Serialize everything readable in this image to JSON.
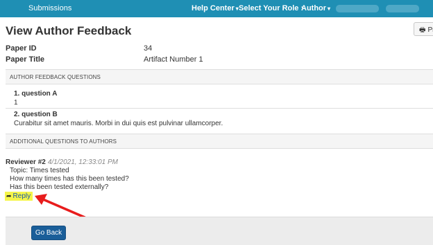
{
  "nav": {
    "submissions": "Submissions",
    "help_center": "Help Center",
    "select_role": "Select Your Role :",
    "role": "Author",
    "caret": "▾"
  },
  "page": {
    "title": "View Author Feedback",
    "print_label": "Pr"
  },
  "info": [
    {
      "label": "Paper ID",
      "value": "34"
    },
    {
      "label": "Paper Title",
      "value": "Artifact Number 1"
    }
  ],
  "sections": {
    "feedback_questions": "AUTHOR FEEDBACK QUESTIONS",
    "additional_questions": "ADDITIONAL QUESTIONS TO AUTHORS"
  },
  "questions": [
    {
      "title": "1. question A",
      "answer": "1"
    },
    {
      "title": "2. question B",
      "answer": "Curabitur sit amet mauris. Morbi in dui quis est pulvinar ullamcorper."
    }
  ],
  "reviewer": {
    "name": "Reviewer #2",
    "timestamp": "4/1/2021, 12:33:01 PM",
    "lines": [
      "Topic: Times tested",
      "How many times has this been tested?",
      "Has this been tested externally?"
    ],
    "reply_label": "Reply"
  },
  "footer": {
    "go_back": "Go Back"
  },
  "colors": {
    "nav_bg": "#1f8fb4",
    "highlight": "#f5f54a",
    "annotation_arrow": "#e81c1c",
    "primary_button": "#1a5e99"
  },
  "icons": {
    "print": "printer-icon",
    "reply": "reply-arrow-icon"
  }
}
